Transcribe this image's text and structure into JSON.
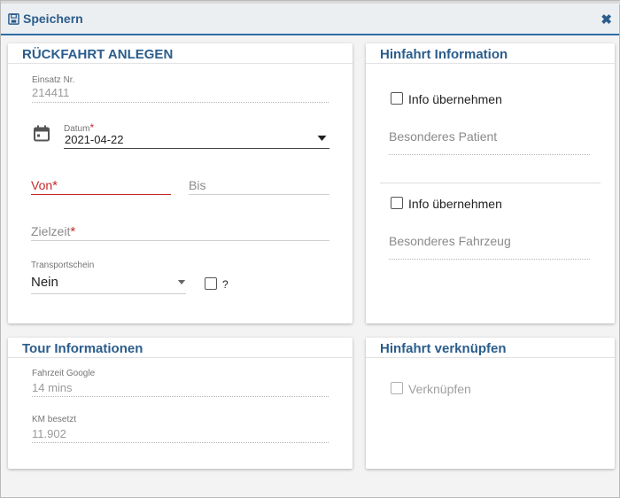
{
  "header": {
    "save_label": "Speichern",
    "close_glyph": "✖",
    "accent_color": "#2b5d8c",
    "icons": [
      "save-icon",
      "close-icon"
    ]
  },
  "rueckfahrt": {
    "title": "RÜCKFAHRT ANLEGEN",
    "einsatz_label": "Einsatz Nr.",
    "einsatz_value": "214411",
    "datum_label": "Datum",
    "datum_value": "2021-04-22",
    "von_placeholder": "Von",
    "bis_placeholder": "Bis",
    "zielzeit_placeholder": "Zielzeit",
    "required_mark": "*",
    "transportschein_label": "Transportschein",
    "transportschein_value": "Nein",
    "question_label": "?"
  },
  "hinfahrt_info": {
    "title": "Hinfahrt Information",
    "info1_label": "Info übernehmen",
    "patient_placeholder": "Besonderes Patient",
    "info2_label": "Info übernehmen",
    "fahrzeug_placeholder": "Besonderes Fahrzeug"
  },
  "tour": {
    "title": "Tour Informationen",
    "fahrzeit_label": "Fahrzeit Google",
    "fahrzeit_value": "14 mins",
    "km_label": "KM besetzt",
    "km_value": "11.902"
  },
  "verknuepfen": {
    "title": "Hinfahrt verknüpfen",
    "checkbox_label": "Verknüpfen"
  }
}
